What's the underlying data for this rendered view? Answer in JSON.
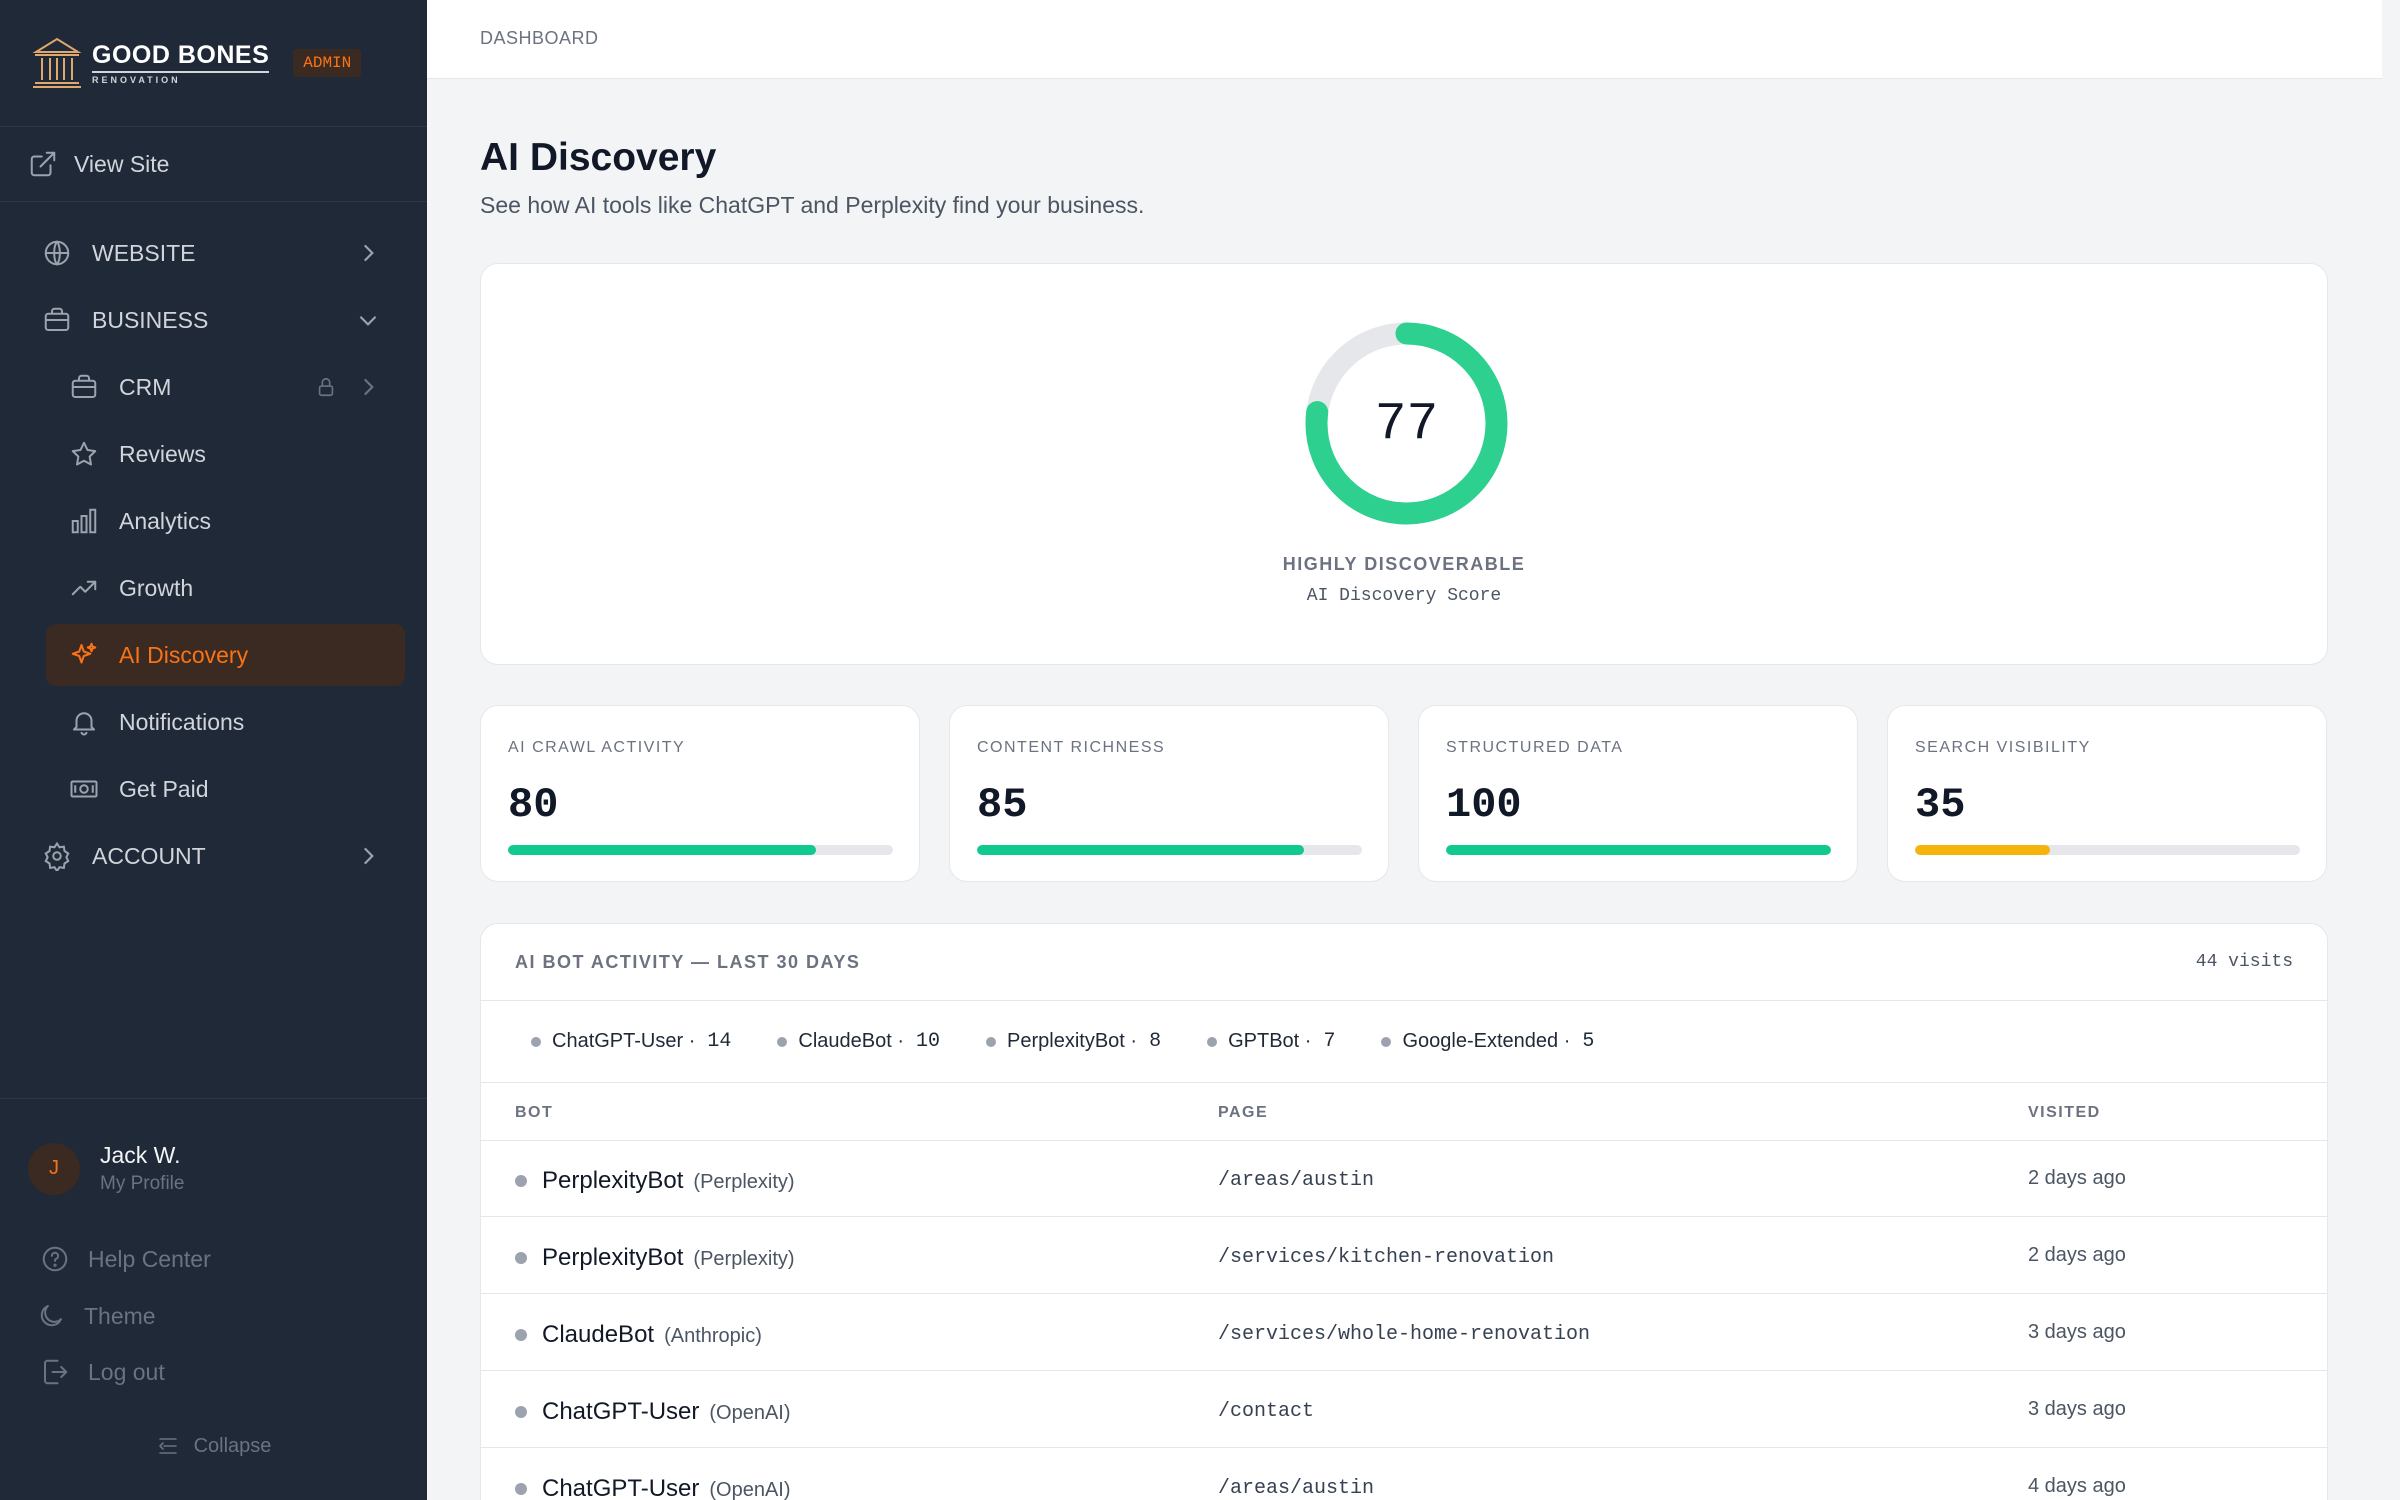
{
  "sidebar": {
    "logo_title": "GOOD BONES",
    "logo_sub": "RENOVATION",
    "badge": "ADMIN",
    "view_site": "View Site",
    "nav": {
      "website": "WEBSITE",
      "business": "BUSINESS",
      "crm": "CRM",
      "reviews": "Reviews",
      "analytics": "Analytics",
      "growth": "Growth",
      "ai_discovery": "AI Discovery",
      "notifications": "Notifications",
      "get_paid": "Get Paid",
      "account": "ACCOUNT"
    },
    "profile": {
      "initial": "J",
      "name": "Jack W.",
      "sub": "My Profile"
    },
    "footer": {
      "help": "Help Center",
      "theme": "Theme",
      "logout": "Log out",
      "collapse": "Collapse"
    }
  },
  "topbar": {
    "breadcrumb": "DASHBOARD"
  },
  "page": {
    "title": "AI Discovery",
    "subtitle": "See how AI tools like ChatGPT and Perplexity find your business."
  },
  "score": {
    "value": "77",
    "percent": 77,
    "label": "HIGHLY DISCOVERABLE",
    "sub": "AI Discovery Score"
  },
  "metrics": [
    {
      "label": "AI CRAWL ACTIVITY",
      "value": "80",
      "percent": 80,
      "color": "#10c98f"
    },
    {
      "label": "CONTENT RICHNESS",
      "value": "85",
      "percent": 85,
      "color": "#10c98f"
    },
    {
      "label": "STRUCTURED DATA",
      "value": "100",
      "percent": 100,
      "color": "#10c98f"
    },
    {
      "label": "SEARCH VISIBILITY",
      "value": "35",
      "percent": 35,
      "color": "#f5b40b"
    }
  ],
  "bot_activity": {
    "title": "AI BOT ACTIVITY — LAST 30 DAYS",
    "visits": "44 visits",
    "legend": [
      {
        "name": "ChatGPT-User ·",
        "count": "14"
      },
      {
        "name": "ClaudeBot ·",
        "count": "10"
      },
      {
        "name": "PerplexityBot ·",
        "count": "8"
      },
      {
        "name": "GPTBot ·",
        "count": "7"
      },
      {
        "name": "Google-Extended ·",
        "count": "5"
      }
    ],
    "columns": {
      "bot": "BOT",
      "page": "PAGE",
      "visited": "VISITED"
    },
    "rows": [
      {
        "bot": "PerplexityBot",
        "org": "(Perplexity)",
        "page": "/areas/austin",
        "visited": "2 days ago"
      },
      {
        "bot": "PerplexityBot",
        "org": "(Perplexity)",
        "page": "/services/kitchen-renovation",
        "visited": "2 days ago"
      },
      {
        "bot": "ClaudeBot",
        "org": "(Anthropic)",
        "page": "/services/whole-home-renovation",
        "visited": "3 days ago"
      },
      {
        "bot": "ChatGPT-User",
        "org": "(OpenAI)",
        "page": "/contact",
        "visited": "3 days ago"
      },
      {
        "bot": "ChatGPT-User",
        "org": "(OpenAI)",
        "page": "/areas/austin",
        "visited": "4 days ago"
      }
    ]
  },
  "colors": {
    "accent": "#f97316",
    "success": "#10c98f",
    "warning": "#f5b40b",
    "sidebar_bg": "#1f2937"
  }
}
